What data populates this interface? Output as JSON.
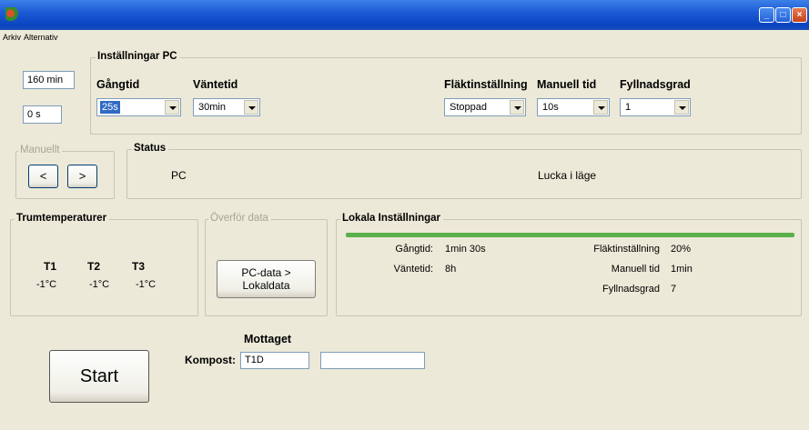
{
  "menu": {
    "arkiv": "Arkiv",
    "alternativ": "Alternativ"
  },
  "window_buttons": {
    "minimize": "_",
    "maximize": "□",
    "close": "×"
  },
  "left": {
    "time_total": "160 min",
    "time_elapsed": "0 s"
  },
  "settings_pc": {
    "title": "Inställningar PC",
    "gangtid": {
      "label": "Gångtid",
      "value": "25s"
    },
    "vantetid": {
      "label": "Väntetid",
      "value": "30min"
    },
    "fakt": {
      "label": "Fläktinställning",
      "value": "Stoppad"
    },
    "manuell": {
      "label": "Manuell tid",
      "value": "10s"
    },
    "fyllnad": {
      "label": "Fyllnadsgrad",
      "value": "1"
    }
  },
  "manuellt": {
    "title": "Manuellt",
    "left": "<",
    "right": ">"
  },
  "status": {
    "title": "Status",
    "pc": "PC",
    "lucka": "Lucka i läge"
  },
  "trum": {
    "title": "Trumtemperaturer",
    "sensors": [
      {
        "name": "T1",
        "value": "-1°C"
      },
      {
        "name": "T2",
        "value": "-1°C"
      },
      {
        "name": "T3",
        "value": "-1°C"
      }
    ]
  },
  "overfor": {
    "title": "Överför data",
    "button_line1": "PC-data >",
    "button_line2": "Lokaldata"
  },
  "lokala": {
    "title": "Lokala Inställningar",
    "progress_percent": 100,
    "progress_color": "#5ab04a",
    "gangtid_label": "Gångtid:",
    "gangtid_value": "1min 30s",
    "vantetid_label": "Väntetid:",
    "vantetid_value": "8h",
    "fakt_label": "Fläktinställning",
    "fakt_value": "20%",
    "manuell_label": "Manuell tid",
    "manuell_value": "1min",
    "fyllnad_label": "Fyllnadsgrad",
    "fyllnad_value": "7"
  },
  "start_label": "Start",
  "mottaget": {
    "header": "Mottaget",
    "kompost_label": "Kompost:",
    "kompost_value": "T1D",
    "extra_value": ""
  }
}
